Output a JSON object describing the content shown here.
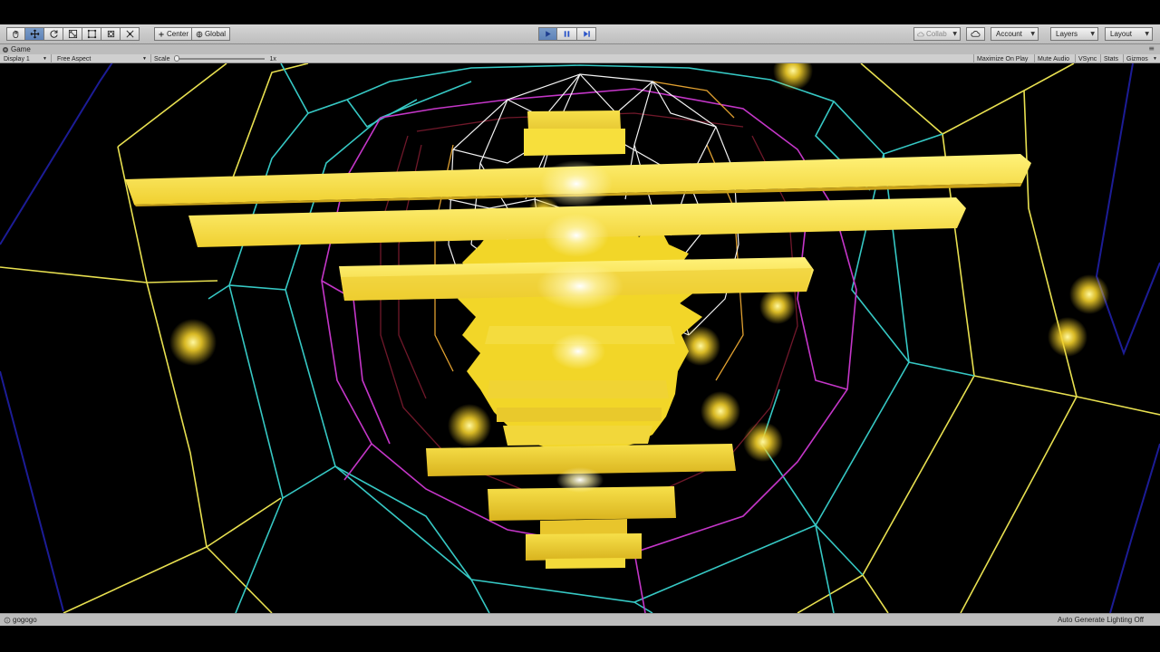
{
  "toolbar": {
    "pivot_label": "Center",
    "space_label": "Global",
    "collab_label": "Collab",
    "account_label": "Account",
    "layers_label": "Layers",
    "layout_label": "Layout"
  },
  "tab": {
    "title": "Game"
  },
  "gameview": {
    "display_label": "Display 1",
    "aspect_label": "Free Aspect",
    "scale_label": "Scale",
    "scale_value": "1x",
    "maximize_label": "Maximize On Play",
    "mute_label": "Mute Audio",
    "vsync_label": "VSync",
    "stats_label": "Stats",
    "gizmos_label": "Gizmos"
  },
  "status": {
    "message": "gogogo",
    "lighting": "Auto Generate Lighting Off"
  },
  "colors": {
    "toolbar_bg": "#c8c8c8",
    "play_active": "#5d82b8",
    "yellow": "#f5d832",
    "cyan": "#38c8c8",
    "magenta": "#c832c8",
    "white": "#ffffff",
    "navy": "#1a1a8c",
    "darkred": "#6a1420"
  }
}
